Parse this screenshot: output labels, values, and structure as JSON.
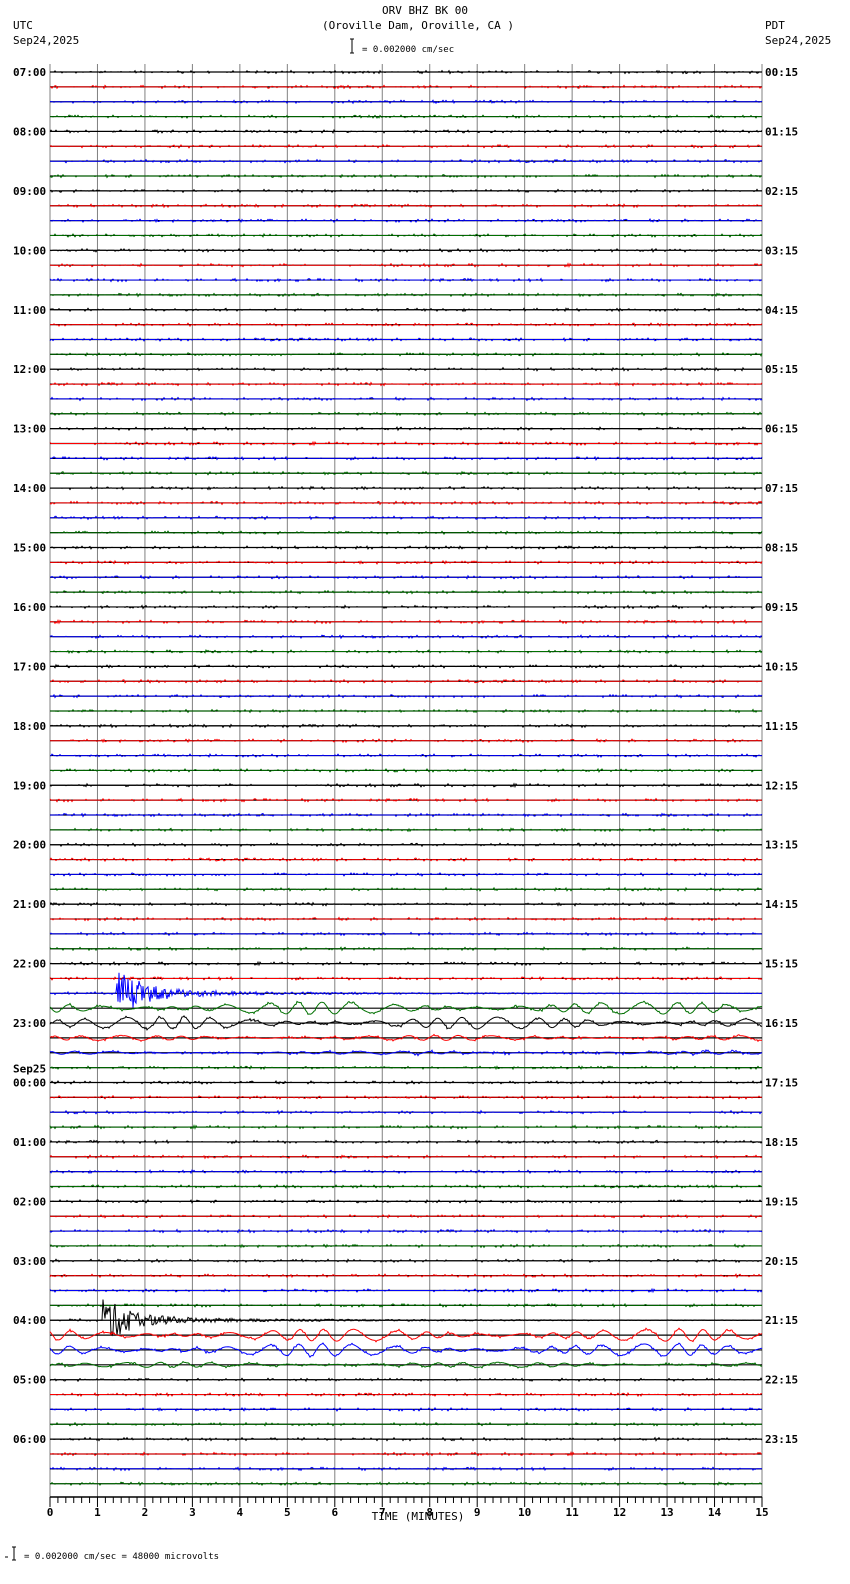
{
  "header": {
    "title": "ORV BHZ BK 00",
    "location": "(Oroville Dam, Oroville, CA )",
    "scale": "= 0.002000 cm/sec",
    "left_tz": "UTC",
    "left_date": "Sep24,2025",
    "right_tz": "PDT",
    "right_date": "Sep24,2025"
  },
  "footer": {
    "scale_note": "= 0.002000 cm/sec =   48000 microvolts"
  },
  "colors": {
    "trace_cycle": [
      "#000000",
      "#ff0000",
      "#0000ff",
      "#007000"
    ],
    "grid": "#808080"
  },
  "chart_data": {
    "type": "line",
    "title": "ORV BHZ BK 00",
    "xlabel": "TIME (MINUTES)",
    "ylabel": "",
    "xlim": [
      0,
      15
    ],
    "x_ticks": [
      "0",
      "1",
      "2",
      "3",
      "4",
      "5",
      "6",
      "7",
      "8",
      "9",
      "10",
      "11",
      "12",
      "13",
      "14",
      "15"
    ],
    "minutes_per_line": 15,
    "line_count": 96,
    "left_labels": [
      {
        "line": 0,
        "text": "07:00"
      },
      {
        "line": 4,
        "text": "08:00"
      },
      {
        "line": 8,
        "text": "09:00"
      },
      {
        "line": 12,
        "text": "10:00"
      },
      {
        "line": 16,
        "text": "11:00"
      },
      {
        "line": 20,
        "text": "12:00"
      },
      {
        "line": 24,
        "text": "13:00"
      },
      {
        "line": 28,
        "text": "14:00"
      },
      {
        "line": 32,
        "text": "15:00"
      },
      {
        "line": 36,
        "text": "16:00"
      },
      {
        "line": 40,
        "text": "17:00"
      },
      {
        "line": 44,
        "text": "18:00"
      },
      {
        "line": 48,
        "text": "19:00"
      },
      {
        "line": 52,
        "text": "20:00"
      },
      {
        "line": 56,
        "text": "21:00"
      },
      {
        "line": 60,
        "text": "22:00"
      },
      {
        "line": 64,
        "text": "23:00"
      },
      {
        "line": 68,
        "text": "00:00",
        "date": "Sep25"
      },
      {
        "line": 72,
        "text": "01:00"
      },
      {
        "line": 76,
        "text": "02:00"
      },
      {
        "line": 80,
        "text": "03:00"
      },
      {
        "line": 84,
        "text": "04:00"
      },
      {
        "line": 88,
        "text": "05:00"
      },
      {
        "line": 92,
        "text": "06:00"
      }
    ],
    "right_labels": [
      {
        "line": 0,
        "text": "00:15"
      },
      {
        "line": 4,
        "text": "01:15"
      },
      {
        "line": 8,
        "text": "02:15"
      },
      {
        "line": 12,
        "text": "03:15"
      },
      {
        "line": 16,
        "text": "04:15"
      },
      {
        "line": 20,
        "text": "05:15"
      },
      {
        "line": 24,
        "text": "06:15"
      },
      {
        "line": 28,
        "text": "07:15"
      },
      {
        "line": 32,
        "text": "08:15"
      },
      {
        "line": 36,
        "text": "09:15"
      },
      {
        "line": 40,
        "text": "10:15"
      },
      {
        "line": 44,
        "text": "11:15"
      },
      {
        "line": 48,
        "text": "12:15"
      },
      {
        "line": 52,
        "text": "13:15"
      },
      {
        "line": 56,
        "text": "14:15"
      },
      {
        "line": 60,
        "text": "15:15"
      },
      {
        "line": 64,
        "text": "16:15"
      },
      {
        "line": 68,
        "text": "17:15"
      },
      {
        "line": 72,
        "text": "18:15"
      },
      {
        "line": 76,
        "text": "19:15"
      },
      {
        "line": 80,
        "text": "20:15"
      },
      {
        "line": 84,
        "text": "21:15"
      },
      {
        "line": 88,
        "text": "22:15"
      },
      {
        "line": 92,
        "text": "23:15"
      }
    ],
    "events": [
      {
        "utc": "22:30",
        "line": 62,
        "onset_minute": 1.4,
        "peak_amplitude": 1.0,
        "coda_lines": [
          63,
          64,
          65,
          66
        ]
      },
      {
        "utc": "04:00",
        "line": 84,
        "onset_minute": 1.1,
        "peak_amplitude": 1.0,
        "coda_lines": [
          85,
          86,
          87
        ]
      }
    ]
  }
}
